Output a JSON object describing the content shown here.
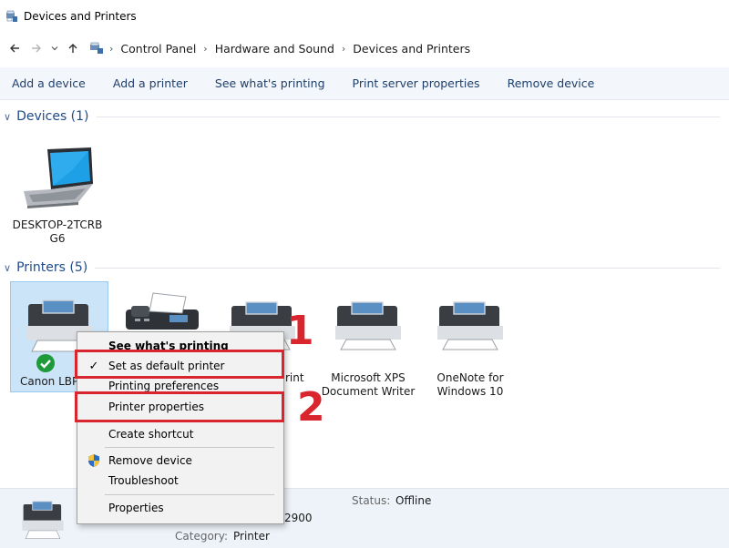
{
  "window": {
    "title": "Devices and Printers"
  },
  "breadcrumb": {
    "items": [
      "Control Panel",
      "Hardware and Sound",
      "Devices and Printers"
    ]
  },
  "toolbar": {
    "items": [
      "Add a device",
      "Add a printer",
      "See what's printing",
      "Print server properties",
      "Remove device"
    ]
  },
  "groups": {
    "devices": {
      "label": "Devices (1)"
    },
    "printers": {
      "label": "Printers (5)"
    }
  },
  "devices": [
    {
      "line1": "DESKTOP-2TCRB",
      "line2": "G6",
      "icon": "laptop-icon"
    }
  ],
  "printers": [
    {
      "label": "Canon LBP",
      "icon": "printer-icon",
      "status_icon": "default-check-icon"
    },
    {
      "label": "",
      "icon": "fax-icon"
    },
    {
      "label": "rint",
      "icon": "printer-icon"
    },
    {
      "line1": "Microsoft XPS",
      "line2": "Document Writer",
      "icon": "printer-icon"
    },
    {
      "line1": "OneNote for",
      "line2": "Windows 10",
      "icon": "printer-icon"
    }
  ],
  "context_menu": {
    "items": [
      {
        "label": "See what's printing",
        "bold": true
      },
      {
        "label": "Set as default printer",
        "checked": true
      },
      {
        "label": "Printing preferences"
      },
      {
        "label": "Printer properties"
      },
      {
        "label": "Create shortcut"
      },
      {
        "label": "Remove device",
        "icon": "shield-icon"
      },
      {
        "label": "Troubleshoot"
      },
      {
        "label": "Properties"
      }
    ]
  },
  "callouts": {
    "first": "1",
    "second": "2"
  },
  "details": {
    "status_label": "Status:",
    "status_value": "Offline",
    "model_fragment": "2900",
    "category_label": "Category:",
    "category_value": "Printer"
  },
  "colors": {
    "accent_red": "#d9252e",
    "link_blue": "#1e4a8a",
    "selection": "#cce4f7",
    "check_green": "#1e9a3a"
  }
}
